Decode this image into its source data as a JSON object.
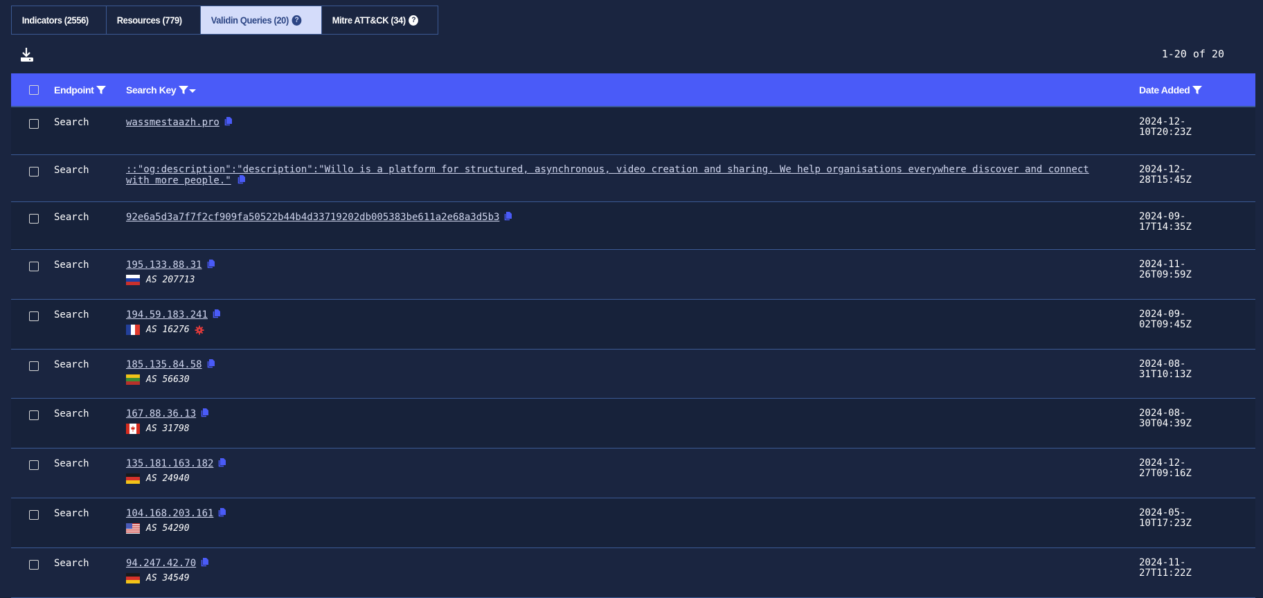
{
  "tabs": [
    {
      "label": "Indicators (2556)",
      "active": false,
      "help": false
    },
    {
      "label": "Resources (779)",
      "active": false,
      "help": false
    },
    {
      "label": "Validin Queries (20)",
      "active": true,
      "help": true
    },
    {
      "label": "Mitre ATT&CK (34)",
      "active": false,
      "help": true
    }
  ],
  "help_glyph": "?",
  "toolbar": {
    "download_icon": "download-icon",
    "pagination": "1-20 of 20"
  },
  "table": {
    "headers": {
      "endpoint": "Endpoint",
      "search_key": "Search Key",
      "date_added": "Date Added"
    },
    "rows": [
      {
        "endpoint": "Search",
        "key": "wassmestaazh.pro",
        "date_line1": "2024-12-",
        "date_line2": "10T20:23Z"
      },
      {
        "endpoint": "Search",
        "key_line1": "::\"og:description\":\"description\":\"Willo is a platform for structured, asynchronous, video creation and sharing. We help organisations everywhere discover and connect",
        "key_line2": "with more people.\"",
        "date_line1": "2024-12-",
        "date_line2": "28T15:45Z"
      },
      {
        "endpoint": "Search",
        "key": "92e6a5d3a7f7f2cf909fa50522b44b4d33719202db005383be611a2e68a3d5b3",
        "date_line1": "2024-09-",
        "date_line2": "17T14:35Z"
      },
      {
        "endpoint": "Search",
        "key": "195.133.88.31",
        "flag": "RU",
        "asn": "AS 207713",
        "date_line1": "2024-11-",
        "date_line2": "26T09:59Z"
      },
      {
        "endpoint": "Search",
        "key": "194.59.183.241",
        "flag": "FR",
        "asn": "AS 16276",
        "threat": true,
        "date_line1": "2024-09-",
        "date_line2": "02T09:45Z"
      },
      {
        "endpoint": "Search",
        "key": "185.135.84.58",
        "flag": "LT",
        "asn": "AS 56630",
        "date_line1": "2024-08-",
        "date_line2": "31T10:13Z"
      },
      {
        "endpoint": "Search",
        "key": "167.88.36.13",
        "flag": "CA",
        "asn": "AS 31798",
        "date_line1": "2024-08-",
        "date_line2": "30T04:39Z"
      },
      {
        "endpoint": "Search",
        "key": "135.181.163.182",
        "flag": "DE",
        "asn": "AS 24940",
        "date_line1": "2024-12-",
        "date_line2": "27T09:16Z"
      },
      {
        "endpoint": "Search",
        "key": "104.168.203.161",
        "flag": "US",
        "asn": "AS 54290",
        "date_line1": "2024-05-",
        "date_line2": "10T17:23Z"
      },
      {
        "endpoint": "Search",
        "key": "94.247.42.70",
        "flag": "DE",
        "asn": "AS 34549",
        "date_line1": "2024-11-",
        "date_line2": "27T11:22Z"
      }
    ]
  },
  "colors": {
    "background": "#1a2540",
    "header": "#4a5bf8",
    "active_tab": "#d4dcfa",
    "copy_icon": "#4a5bf8",
    "threat_icon": "#e03a3a",
    "divider": "#3c5a94"
  }
}
